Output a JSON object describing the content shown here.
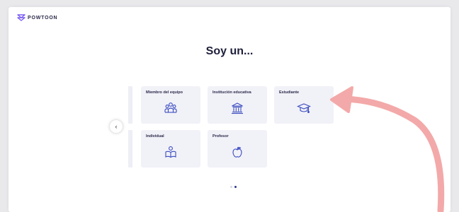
{
  "brand": {
    "name": "POWTOON"
  },
  "headline": "Soy un...",
  "tiles": [
    {
      "label": "Miembro del equipo",
      "icon": "team-icon"
    },
    {
      "label": "Institución educativa",
      "icon": "institution-icon"
    },
    {
      "label": "Estudiante",
      "icon": "graduation-cap-icon"
    },
    {
      "label": "Individual",
      "icon": "person-reading-icon"
    },
    {
      "label": "Profesor",
      "icon": "apple-icon"
    }
  ],
  "nav": {
    "prev_icon": "chevron-left-icon",
    "prev_glyph": "‹"
  },
  "pagination": {
    "total": 2,
    "current": 2
  },
  "colors": {
    "icon": "#3b4cc0",
    "tile_bg": "#f1f1f8",
    "arrow": "#f2a7a7",
    "headline": "#1e1f3b"
  }
}
